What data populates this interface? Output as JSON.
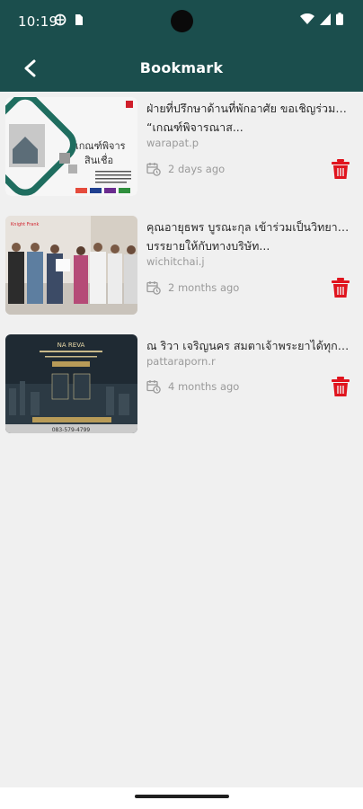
{
  "status": {
    "time": "10:19"
  },
  "appbar": {
    "title": "Bookmark"
  },
  "items": [
    {
      "line1": "ฝ่ายที่ปรึกษาด้านที่พักอาศัย ขอเชิญร่วมรับฟัง",
      "line2": "“เกณฑ์พิจารณาส...",
      "author": "warapat.p",
      "time": "2 days ago",
      "thumb": {
        "heading": "เกณฑ์พิจาร",
        "sub": "สินเชื่อ"
      }
    },
    {
      "line1": "คุณอายุธพร บูรณะกุล เข้าร่วมเป็นวิทยากร",
      "line2": "บรรยายให้กับทางบริษัท...",
      "author": "wichitchai.j",
      "time": "2 months ago",
      "thumb": {
        "heading": "",
        "sub": ""
      }
    },
    {
      "line1": "ณ ริวา เจริญนคร สมตาเจ้าพระยาได้ทุกนาที",
      "line2": "",
      "author": "pattaraporn.r",
      "time": "4 months ago",
      "thumb": {
        "heading": "NA REVA",
        "sub": "083-579-4799"
      }
    }
  ],
  "colors": {
    "appbar": "#1b4e4d",
    "delete": "#e0141e",
    "background": "#f0f0f0"
  }
}
